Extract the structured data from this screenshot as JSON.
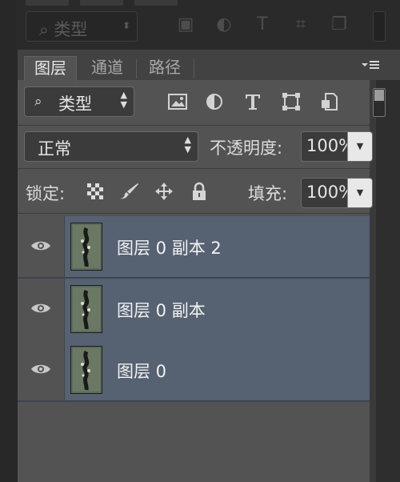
{
  "panel_tabs": [
    {
      "label": "图层",
      "active": true
    },
    {
      "label": "通道",
      "active": false
    },
    {
      "label": "路径",
      "active": false
    }
  ],
  "filter": {
    "kind_label": "类型",
    "icons": [
      "image-filter-icon",
      "adjustment-filter-icon",
      "type-filter-icon",
      "shape-filter-icon",
      "smart-object-filter-icon"
    ]
  },
  "blend": {
    "mode": "正常",
    "opacity_label": "不透明度:",
    "opacity_value": "100%"
  },
  "lock": {
    "label": "锁定:",
    "fill_label": "填充:",
    "fill_value": "100%",
    "icons": [
      "lock-transparent-pixels-icon",
      "lock-image-pixels-icon",
      "lock-position-icon",
      "lock-all-icon"
    ]
  },
  "layers": [
    {
      "name": "图层 0 副本 2",
      "visible": true,
      "selected": true
    },
    {
      "name": "图层 0 副本",
      "visible": true,
      "selected": true
    },
    {
      "name": "图层 0",
      "visible": true,
      "selected": true
    }
  ],
  "colors": {
    "panel_bg": "#535353",
    "selected_layer_bg": "#566172",
    "dark_bg": "#282828"
  }
}
